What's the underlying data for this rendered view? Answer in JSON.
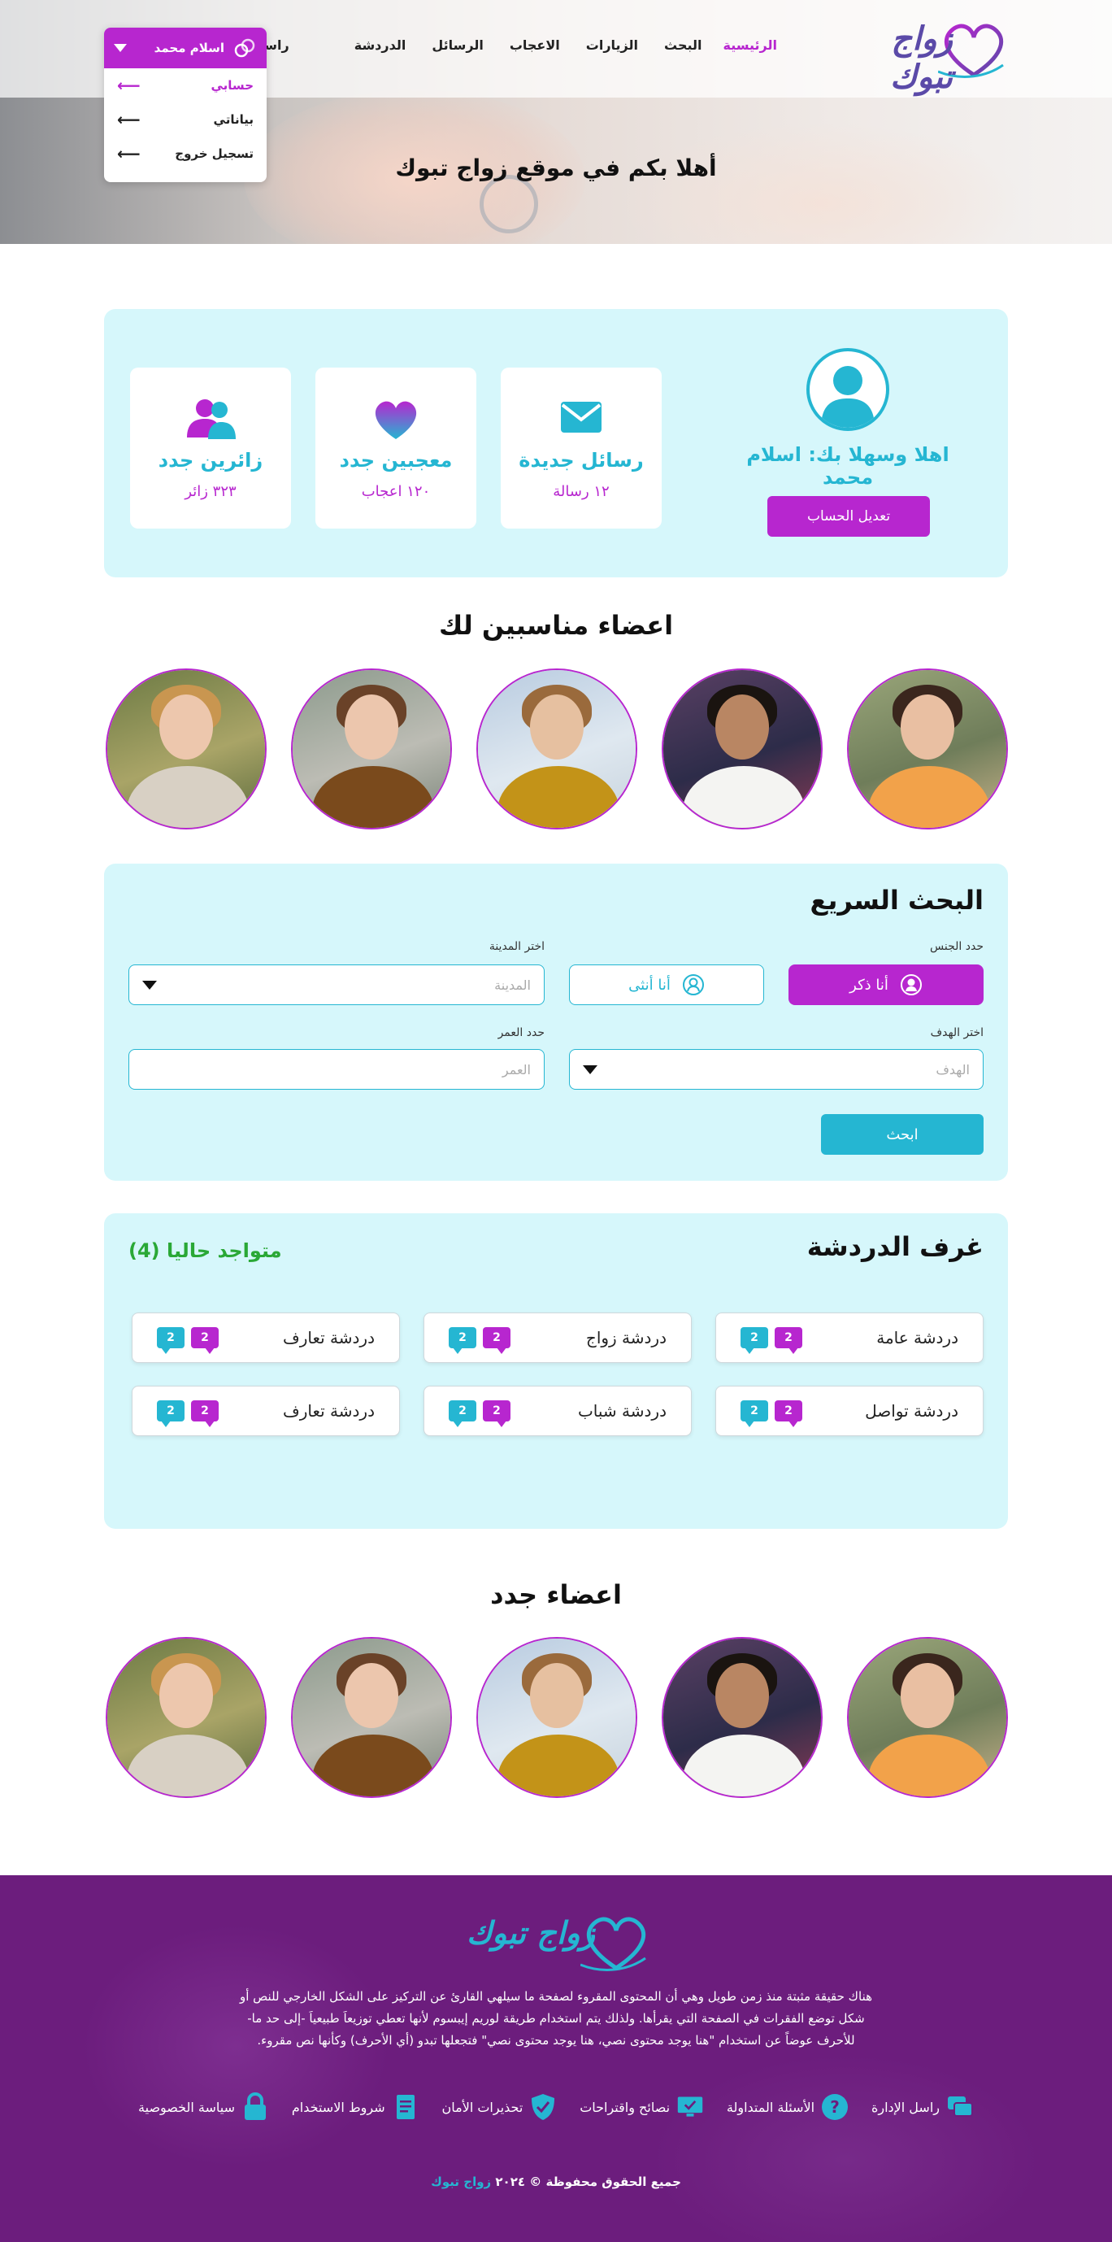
{
  "colors": {
    "accent_purple": "#b726cf",
    "accent_teal": "#25b6d2",
    "panel_bg": "#d6f7fb",
    "footer_bg": "#6c1d7d",
    "online_green": "#2aa836"
  },
  "brand": {
    "logo_text": "زواج تبوك"
  },
  "nav": {
    "items": [
      {
        "label": "الرئيسية",
        "active": true
      },
      {
        "label": "البحث"
      },
      {
        "label": "الزيارات"
      },
      {
        "label": "الاعجاب"
      },
      {
        "label": "الرسائل"
      },
      {
        "label": "الدردشة"
      },
      {
        "label": "راسل الادارة"
      }
    ]
  },
  "user_menu": {
    "user_name": "اسلام محمد",
    "icon": "rings-icon",
    "items": [
      {
        "label": "حسابي",
        "active": true
      },
      {
        "label": "بياناتي"
      },
      {
        "label": "تسجيل خروج"
      }
    ]
  },
  "hero": {
    "title": "أهلا بكم في موقع زواج تبوك"
  },
  "profile": {
    "welcome": "اهلا وسهلا بك: اسلام محمد",
    "edit_button": "تعديل الحساب",
    "stats": [
      {
        "label": "رسائل جديدة",
        "count": "١٢ رسالة",
        "icon": "envelope-icon"
      },
      {
        "label": "معجبين جدد",
        "count": "١٢٠ اعجاب",
        "icon": "heart-icon"
      },
      {
        "label": "زائرين جدد",
        "count": "٣٢٣ زائر",
        "icon": "visitors-icon"
      }
    ]
  },
  "suggested": {
    "title": "اعضاء مناسبين لك"
  },
  "search": {
    "title": "البحث السريع",
    "gender_label": "حدد الجنس",
    "male": "أنا ذكر",
    "female": "أنا أنثى",
    "city_label": "اختر المدينة",
    "city_placeholder": "المدينة",
    "goal_label": "اختر الهدف",
    "goal_placeholder": "الهدف",
    "age_label": "حدد العمر",
    "age_placeholder": "العمر",
    "button": "ابحث"
  },
  "chat": {
    "title": "غرف الدردشة",
    "online": "متواجد حاليا (4)",
    "rooms": [
      {
        "name": "دردشة عامة",
        "purple_badge": "2",
        "teal_badge": "2"
      },
      {
        "name": "دردشة زواج",
        "purple_badge": "2",
        "teal_badge": "2"
      },
      {
        "name": "دردشة تعارف",
        "purple_badge": "2",
        "teal_badge": "2"
      },
      {
        "name": "دردشة تواصل",
        "purple_badge": "2",
        "teal_badge": "2"
      },
      {
        "name": "دردشة شباب",
        "purple_badge": "2",
        "teal_badge": "2"
      },
      {
        "name": "دردشة تعارف",
        "purple_badge": "2",
        "teal_badge": "2"
      }
    ]
  },
  "new_members": {
    "title": "اعضاء جدد"
  },
  "footer": {
    "description": "هناك حقيقة مثبتة منذ زمن طويل وهي أن المحتوى المقروء لصفحة ما سيلهي القارئ عن التركيز على الشكل الخارجي للنص أو شكل توضع الفقرات في الصفحة التي يقرأها. ولذلك يتم استخدام طريقة لوريم إيبسوم لأنها تعطي توزيعاَ طبيعياَ -إلى حد ما- للأحرف عوضاً عن استخدام \"هنا يوجد محتوى نصي، هنا يوجد محتوى نصي\" فتجعلها تبدو (أي الأحرف) وكأنها نص مقروء.",
    "links": [
      {
        "label": "راسل الإدارة",
        "icon": "chat-bubbles-icon"
      },
      {
        "label": "الأسئلة المتداولة",
        "icon": "question-icon"
      },
      {
        "label": "نصائح واقتراحات",
        "icon": "monitor-check-icon"
      },
      {
        "label": "تحذيرات الأمان",
        "icon": "shield-check-icon"
      },
      {
        "label": "شروط الاستخدام",
        "icon": "document-icon"
      },
      {
        "label": "سياسة الخصوصية",
        "icon": "lock-icon"
      }
    ],
    "copyright_prefix": "جميع الحقوق محفوظة © ٢٠٢٤",
    "copyright_brand": "زواج تبوك"
  }
}
